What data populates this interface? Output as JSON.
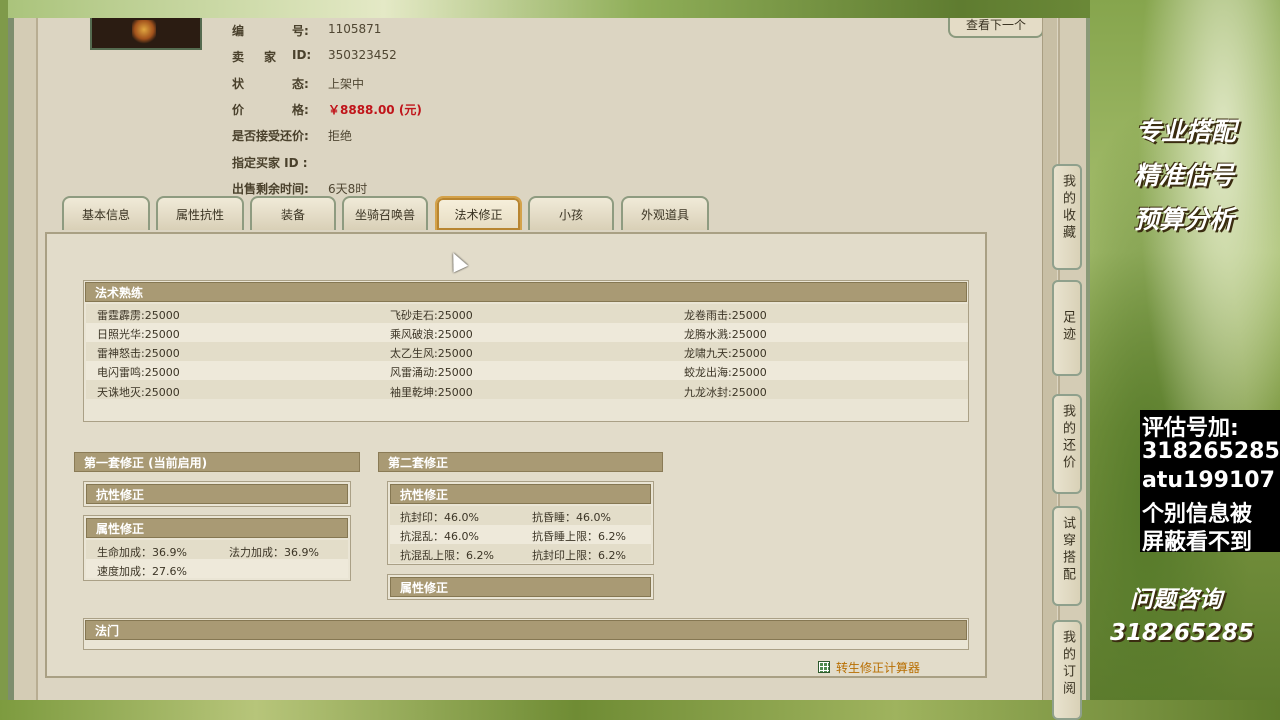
{
  "header": {
    "next_label": "查看下一个"
  },
  "info": [
    {
      "l1": "编",
      "l3": "号:",
      "value": "1105871"
    },
    {
      "l1": "卖",
      "l2": "家",
      "l3": "ID:",
      "value": "350323452"
    },
    {
      "l1": "状",
      "l3": "态:",
      "value": "上架中"
    },
    {
      "l1": "价",
      "l3": "格:",
      "value": "￥8888.00 (元)"
    },
    {
      "label": "是否接受还价:",
      "value": "拒绝"
    },
    {
      "label": "指定买家 ID :",
      "value": ""
    },
    {
      "label": "出售剩余时间:",
      "value": "6天8时"
    }
  ],
  "tabs": [
    "基本信息",
    "属性抗性",
    "装备",
    "坐骑召唤兽",
    "法术修正",
    "小孩",
    "外观道具"
  ],
  "active_tab": "法术修正",
  "skills": {
    "title": "法术熟练",
    "items": [
      [
        "雷霆霹雳:25000",
        "飞砂走石:25000",
        "龙卷雨击:25000"
      ],
      [
        "日照光华:25000",
        "乘风破浪:25000",
        "龙腾水溅:25000"
      ],
      [
        "雷神怒击:25000",
        "太乙生风:25000",
        "龙啸九天:25000"
      ],
      [
        "电闪雷鸣:25000",
        "风雷涌动:25000",
        "蛟龙出海:25000"
      ],
      [
        "天诛地灭:25000",
        "袖里乾坤:25000",
        "九龙冰封:25000"
      ]
    ]
  },
  "set1": {
    "title": "第一套修正 (当前启用)",
    "resist_title": "抗性修正",
    "attr_title": "属性修正",
    "attrs": [
      "生命加成：36.9%",
      "法力加成：36.9%",
      "速度加成：27.6%"
    ]
  },
  "set2": {
    "title": "第二套修正",
    "resist_title": "抗性修正",
    "resists": [
      "抗封印：46.0%",
      "抗昏睡：46.0%",
      "抗混乱：46.0%",
      "抗昏睡上限：6.2%",
      "抗混乱上限：6.2%",
      "抗封印上限：6.2%"
    ],
    "attr_title": "属性修正"
  },
  "fameng_title": "法门",
  "calc_label": "转生修正计算器",
  "side_menu": [
    "我的收藏",
    "足迹",
    "我的还价",
    "试穿搭配",
    "我的订阅"
  ],
  "promo": [
    "专业搭配",
    "精准估号",
    "预算分析"
  ],
  "black_box": [
    "评估号加:",
    "318265285",
    "atu199107",
    "个别信息被",
    "屏蔽看不到"
  ],
  "ask": [
    "问题咨询",
    "318265285"
  ]
}
